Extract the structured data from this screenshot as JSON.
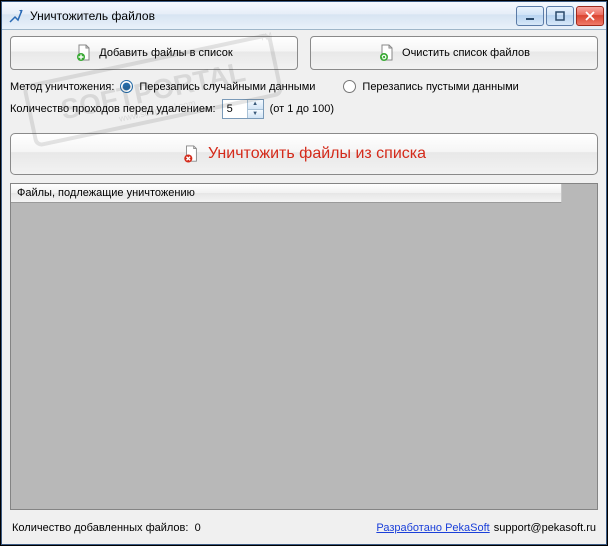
{
  "window": {
    "title": "Уничтожитель файлов"
  },
  "toolbar": {
    "add_label": "Добавить файлы в список",
    "clear_label": "Очистить список файлов"
  },
  "options": {
    "method_label": "Метод уничтожения:",
    "method_random": "Перезапись случайными данными",
    "method_empty": "Перезапись пустыми данными",
    "passes_label": "Количество проходов перед удалением:",
    "passes_value": "5",
    "passes_range": "(от 1 до 100)"
  },
  "destroy": {
    "label": "Уничтожить файлы из списка"
  },
  "list": {
    "header": "Файлы, подлежащие уничтожению"
  },
  "status": {
    "count_label": "Количество добавленных файлов:",
    "count_value": "0",
    "dev_label": "Разработано PekaSoft",
    "email": "support@pekasoft.ru"
  }
}
